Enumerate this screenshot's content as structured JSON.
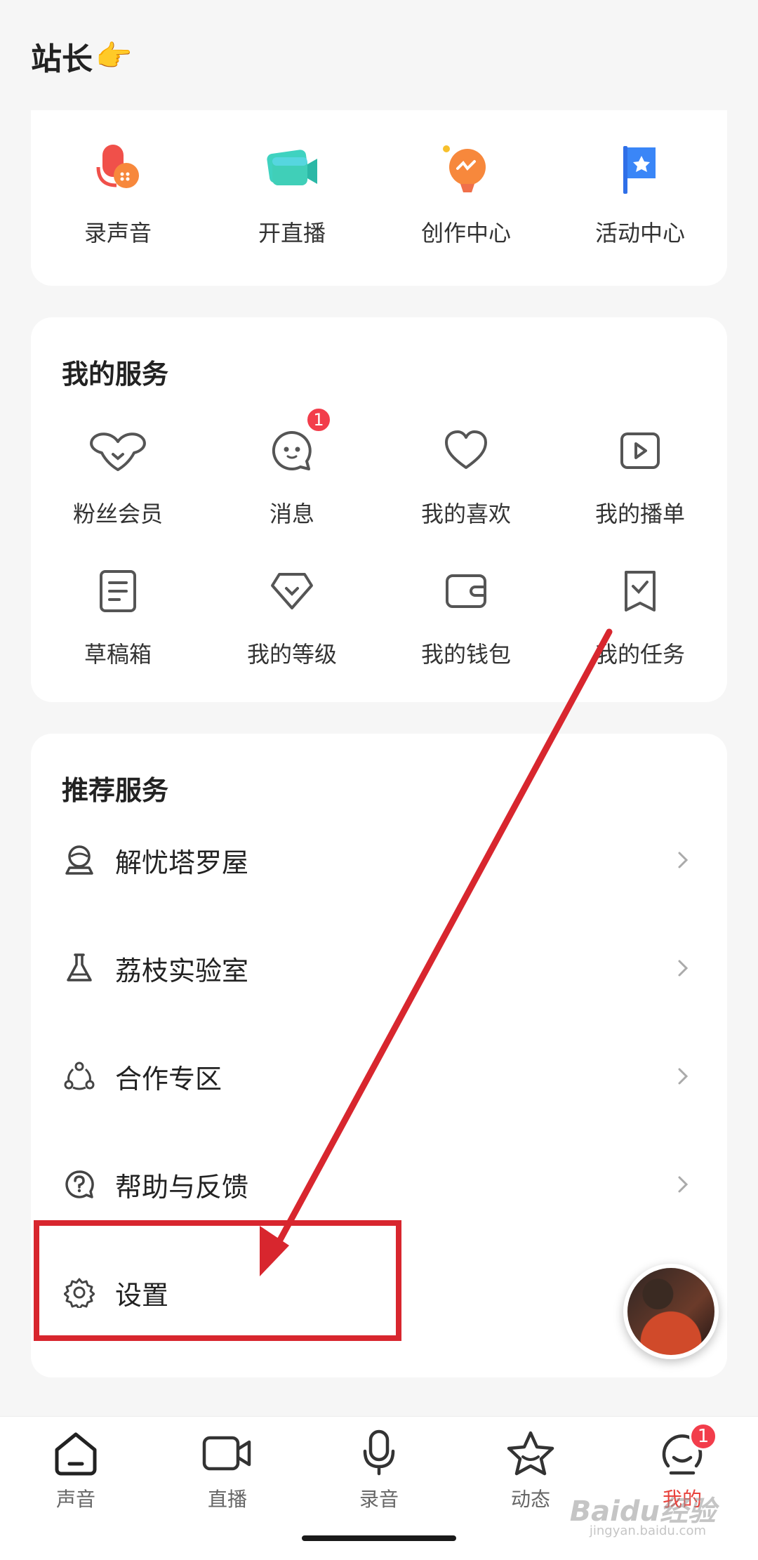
{
  "header": {
    "title": "站长",
    "pointer_emoji": "👉"
  },
  "quick_actions": [
    {
      "label": "录声音",
      "icon": "record-voice-icon"
    },
    {
      "label": "开直播",
      "icon": "start-live-icon"
    },
    {
      "label": "创作中心",
      "icon": "creator-center-icon"
    },
    {
      "label": "活动中心",
      "icon": "activity-center-icon"
    }
  ],
  "my_services": {
    "title": "我的服务",
    "items": [
      {
        "label": "粉丝会员",
        "icon": "fan-member-icon"
      },
      {
        "label": "消息",
        "icon": "message-icon",
        "badge": "1"
      },
      {
        "label": "我的喜欢",
        "icon": "heart-icon"
      },
      {
        "label": "我的播单",
        "icon": "playlist-icon"
      },
      {
        "label": "草稿箱",
        "icon": "draft-icon"
      },
      {
        "label": "我的等级",
        "icon": "level-icon"
      },
      {
        "label": "我的钱包",
        "icon": "wallet-icon"
      },
      {
        "label": "我的任务",
        "icon": "task-icon"
      }
    ]
  },
  "recommended": {
    "title": "推荐服务",
    "items": [
      {
        "label": "解忧塔罗屋",
        "icon": "crystal-ball-icon"
      },
      {
        "label": "荔枝实验室",
        "icon": "flask-icon"
      },
      {
        "label": "合作专区",
        "icon": "cooperation-icon"
      },
      {
        "label": "帮助与反馈",
        "icon": "help-icon"
      },
      {
        "label": "设置",
        "icon": "gear-icon"
      }
    ]
  },
  "tabbar": {
    "items": [
      {
        "label": "声音",
        "icon": "home-icon"
      },
      {
        "label": "直播",
        "icon": "video-camera-icon"
      },
      {
        "label": "录音",
        "icon": "microphone-icon"
      },
      {
        "label": "动态",
        "icon": "star-icon"
      },
      {
        "label": "我的",
        "icon": "profile-icon",
        "badge": "1",
        "active": true
      }
    ]
  },
  "watermark": {
    "text": "Baidu经验",
    "sub": "jingyan.baidu.com"
  },
  "colors": {
    "accent": "#e8423c",
    "annotation": "#d8262e",
    "badge": "#f23d4b"
  }
}
